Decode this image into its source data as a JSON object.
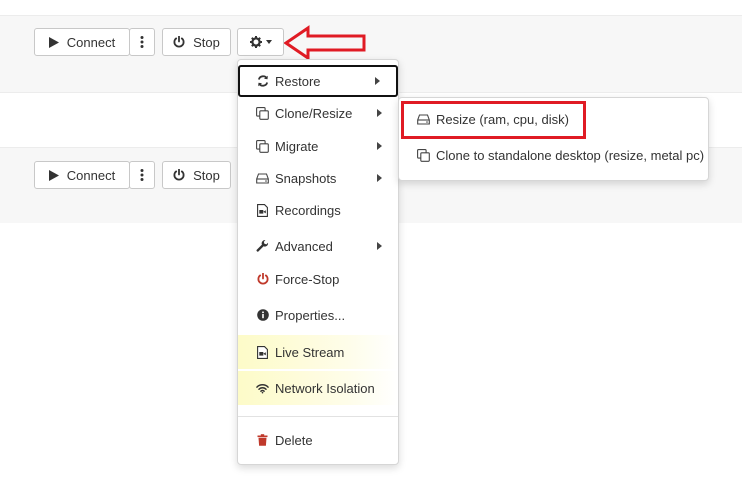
{
  "rows": [
    {
      "connect_label": "Connect",
      "stop_label": "Stop"
    },
    {
      "connect_label": "Connect",
      "stop_label": "Stop"
    }
  ],
  "menu": {
    "items": [
      {
        "label": "Restore",
        "icon": "refresh-icon",
        "submenu": true
      },
      {
        "label": "Clone/Resize",
        "icon": "clone-icon",
        "submenu": true
      },
      {
        "label": "Migrate",
        "icon": "clone-icon",
        "submenu": true
      },
      {
        "label": "Snapshots",
        "icon": "drive-icon",
        "submenu": true
      },
      {
        "label": "Recordings",
        "icon": "video-file-icon",
        "submenu": false
      },
      {
        "label": "Advanced",
        "icon": "wrench-icon",
        "submenu": true
      },
      {
        "label": "Force-Stop",
        "icon": "power-icon",
        "submenu": false
      },
      {
        "label": "Properties...",
        "icon": "info-icon",
        "submenu": false
      },
      {
        "label": "Live Stream",
        "icon": "video-file-icon",
        "submenu": false
      },
      {
        "label": "Network Isolation",
        "icon": "wifi-icon",
        "submenu": false
      },
      {
        "label": "Delete",
        "icon": "trash-icon",
        "submenu": false
      }
    ]
  },
  "submenu": {
    "items": [
      {
        "label": "Resize (ram, cpu, disk)",
        "icon": "drive-icon"
      },
      {
        "label": "Clone to standalone desktop (resize, metal pc)",
        "icon": "clone-icon"
      }
    ]
  },
  "colors": {
    "annotation_red": "#e01b24",
    "danger": "#c0392b",
    "highlight": "#fdfbc8"
  }
}
